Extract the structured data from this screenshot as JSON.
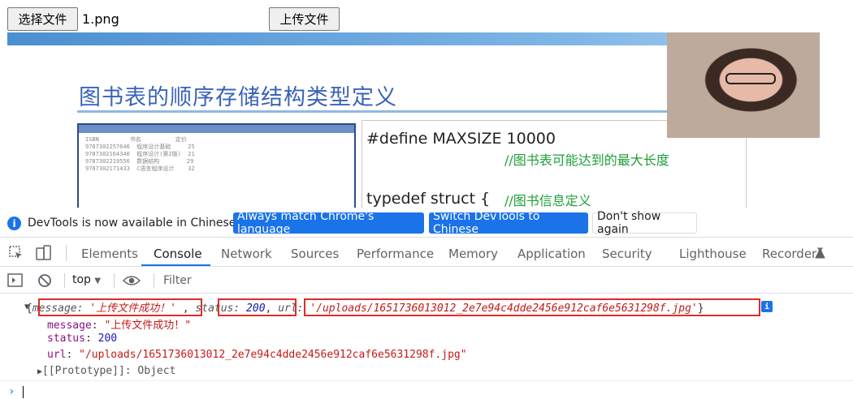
{
  "form": {
    "choose_file_label": "选择文件",
    "file_name": "1.png",
    "upload_label": "上传文件"
  },
  "preview": {
    "title": "图书表的顺序存储结构类型定义",
    "code_define": "#define MAXSIZE 10000",
    "code_comment1": "//图书表可能达到的最大长度",
    "code_typedef": "typedef struct  {",
    "code_comment2": "//图书信息定义"
  },
  "banner": {
    "text": "DevTools is now available in Chinese!",
    "match_label": "Always match Chrome's language",
    "switch_label": "Switch DevTools to Chinese",
    "dont_label": "Don't show again"
  },
  "tabs": [
    {
      "label": "Elements"
    },
    {
      "label": "Console"
    },
    {
      "label": "Network"
    },
    {
      "label": "Sources"
    },
    {
      "label": "Performance"
    },
    {
      "label": "Memory"
    },
    {
      "label": "Application"
    },
    {
      "label": "Security"
    },
    {
      "label": "Lighthouse"
    },
    {
      "label": "Recorder"
    }
  ],
  "console_toolbar": {
    "context": "top",
    "filter_placeholder": "Filter"
  },
  "console": {
    "summary": {
      "message_key": "message:",
      "message_val": "'上传文件成功！'",
      "status_key": "status:",
      "status_val": "200",
      "url_key": "url:",
      "url_val": "'/uploads/1651736013012_2e7e94c4dde2456e912caf6e5631298f.jpg'"
    },
    "props": [
      {
        "key": "message",
        "value": "\"上传文件成功！\""
      },
      {
        "key": "status",
        "value": "200"
      },
      {
        "key": "url",
        "value": "\"/uploads/1651736013012_2e7e94c4dde2456e912caf6e5631298f.jpg\""
      }
    ],
    "prototype": "[[Prototype]]: Object"
  },
  "colors": {
    "accent": "#1a73e8",
    "highlight": "#e02b2b"
  }
}
